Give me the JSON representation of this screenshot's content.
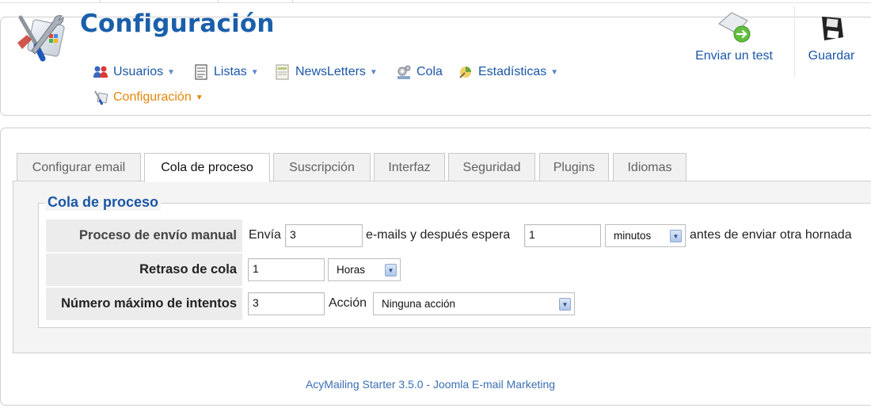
{
  "header": {
    "title": "Configuración",
    "nav": [
      {
        "label": "Usuarios",
        "icon": "users-icon",
        "dropdown": true
      },
      {
        "label": "Listas",
        "icon": "list-icon",
        "dropdown": true
      },
      {
        "label": "NewsLetters",
        "icon": "newsletter-icon",
        "dropdown": true
      },
      {
        "label": "Cola",
        "icon": "queue-icon",
        "dropdown": false
      },
      {
        "label": "Estadísticas",
        "icon": "statistics-icon",
        "dropdown": true
      },
      {
        "label": "Configuración",
        "icon": "configuration-icon",
        "dropdown": true,
        "active": true
      }
    ],
    "toolbar": {
      "send_test_label": "Enviar un test",
      "save_label": "Guardar"
    }
  },
  "tabs": [
    {
      "label": "Configurar email"
    },
    {
      "label": "Cola de proceso",
      "active": true
    },
    {
      "label": "Suscripción"
    },
    {
      "label": "Interfaz"
    },
    {
      "label": "Seguridad"
    },
    {
      "label": "Plugins"
    },
    {
      "label": "Idiomas"
    }
  ],
  "queue": {
    "legend": "Cola de proceso",
    "manual": {
      "label": "Proceso de envío manual",
      "text_sends": "Envía",
      "emails_value": "3",
      "text_wait": "e-mails y después espera",
      "wait_value": "1",
      "wait_unit": "minutos",
      "text_after": "antes de enviar otra hornada"
    },
    "delay": {
      "label": "Retraso de cola",
      "value": "1",
      "unit": "Horas"
    },
    "attempts": {
      "label": "Número máximo de intentos",
      "value": "3",
      "action_label": "Acción",
      "action_value": "Ninguna acción"
    }
  },
  "footer": {
    "text": "AcyMailing Starter 3.5.0 - Joomla E-mail Marketing"
  },
  "colors": {
    "brand_blue": "#1a5fab",
    "link_blue": "#1b57a6",
    "active_orange": "#e3860c"
  }
}
